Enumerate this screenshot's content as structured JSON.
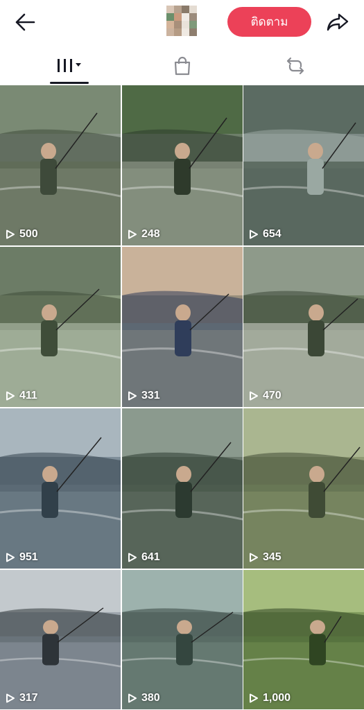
{
  "header": {
    "back_icon": "arrow-left-icon",
    "avatar_icon": "pixelated-avatar",
    "follow_label": "ติดตาม",
    "share_icon": "share-arrow-icon"
  },
  "tabs": [
    {
      "icon": "grid-icon",
      "active": true
    },
    {
      "icon": "shopping-bag-icon",
      "active": false
    },
    {
      "icon": "repost-icon",
      "active": false
    }
  ],
  "colors": {
    "follow_button": "#ec4158",
    "text_dark": "#161823"
  },
  "videos": [
    {
      "views": "500"
    },
    {
      "views": "248"
    },
    {
      "views": "654"
    },
    {
      "views": "411"
    },
    {
      "views": "331"
    },
    {
      "views": "470"
    },
    {
      "views": "951"
    },
    {
      "views": "641"
    },
    {
      "views": "345"
    },
    {
      "views": "317"
    },
    {
      "views": "380"
    },
    {
      "views": "1,000"
    }
  ]
}
